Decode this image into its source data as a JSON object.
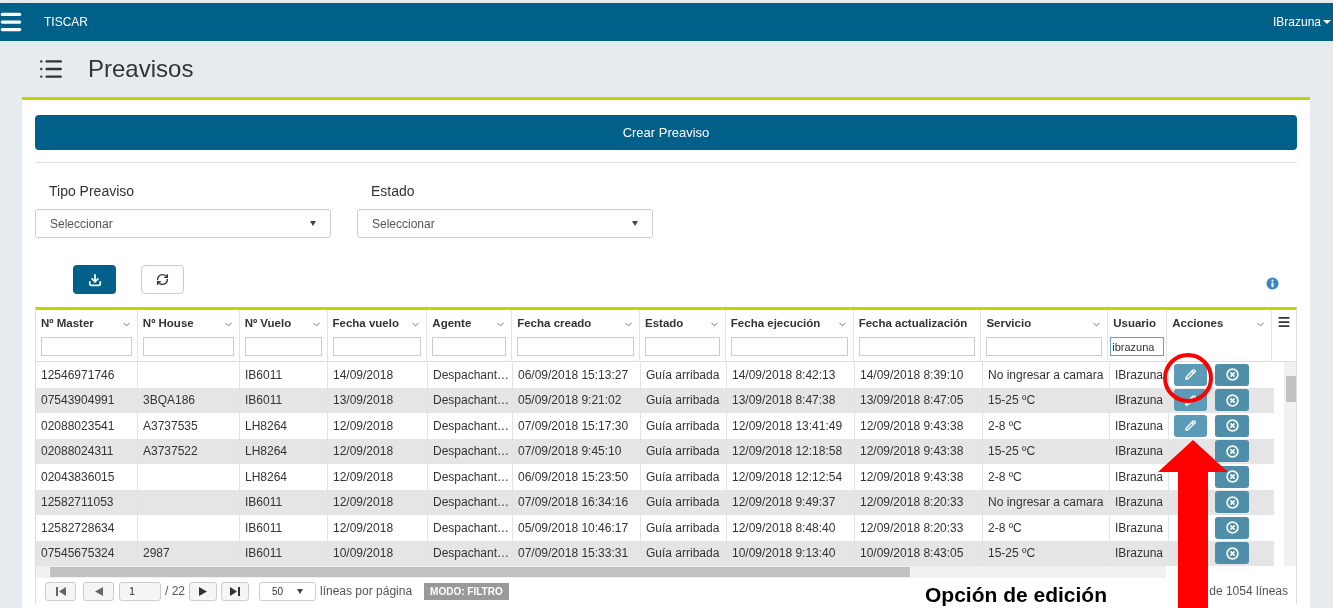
{
  "app_bar": {
    "title": "TISCAR",
    "user": "IBrazuna"
  },
  "page": {
    "title": "Preavisos"
  },
  "create_button": "Crear Preaviso",
  "filters": [
    {
      "label": "Tipo Preaviso",
      "value": "Seleccionar"
    },
    {
      "label": "Estado",
      "value": "Seleccionar"
    }
  ],
  "table": {
    "columns": [
      {
        "label": "Nº Master",
        "caret": true,
        "kind": "filter"
      },
      {
        "label": "Nº House",
        "caret": true,
        "kind": "filter"
      },
      {
        "label": "Nº Vuelo",
        "caret": true,
        "kind": "filter"
      },
      {
        "label": "Fecha vuelo",
        "caret": true,
        "kind": "filter"
      },
      {
        "label": "Agente",
        "caret": true,
        "kind": "filter"
      },
      {
        "label": "Fecha creado",
        "caret": true,
        "kind": "filter"
      },
      {
        "label": "Estado",
        "caret": true,
        "kind": "filter"
      },
      {
        "label": "Fecha ejecución",
        "caret": true,
        "kind": "filter"
      },
      {
        "label": "Fecha actualización",
        "caret": false,
        "kind": "filter"
      },
      {
        "label": "Servicio",
        "caret": true,
        "kind": "filter"
      },
      {
        "label": "Usuario",
        "caret": false,
        "kind": "filter",
        "filter_value": "ibrazuna"
      },
      {
        "label": "Acciones",
        "caret": true,
        "kind": "actions"
      }
    ],
    "rows": [
      {
        "cells": [
          "12546971746",
          null,
          "IB6011",
          "14/09/2018",
          "Despachant…",
          "06/09/2018 15:13:27",
          "Guía arribada",
          "14/09/2018 8:42:13",
          "14/09/2018 8:39:10",
          "No ingresar a camara",
          "IBrazuna"
        ]
      },
      {
        "cells": [
          "07543904991",
          "3BQA186",
          "IB6011",
          "13/09/2018",
          "Despachant…",
          "05/09/2018 9:21:02",
          "Guía arribada",
          "13/09/2018 8:47:38",
          "13/09/2018 8:47:05",
          "15-25 ºC",
          "IBrazuna"
        ]
      },
      {
        "cells": [
          "02088023541",
          "A3737535",
          "LH8264",
          "12/09/2018",
          "Despachant…",
          "07/09/2018 15:17:30",
          "Guía arribada",
          "12/09/2018 13:41:49",
          "12/09/2018 9:43:38",
          "2-8 ºC",
          "IBrazuna"
        ]
      },
      {
        "cells": [
          "02088024311",
          "A3737522",
          "LH8264",
          "12/09/2018",
          "Despachant…",
          "07/09/2018 9:45:10",
          "Guía arribada",
          "12/09/2018 12:18:58",
          "12/09/2018 9:43:38",
          "15-25 ºC",
          "IBrazuna"
        ]
      },
      {
        "cells": [
          "02043836015",
          null,
          "LH8264",
          "12/09/2018",
          "Despachant…",
          "06/09/2018 15:23:50",
          "Guía arribada",
          "12/09/2018 12:12:54",
          "12/09/2018 9:43:38",
          "2-8 ºC",
          "IBrazuna"
        ]
      },
      {
        "cells": [
          "12582711053",
          null,
          "IB6011",
          "12/09/2018",
          "Despachant…",
          "07/09/2018 16:34:16",
          "Guía arribada",
          "12/09/2018 9:49:37",
          "12/09/2018 8:20:33",
          "No ingresar a camara",
          "IBrazuna"
        ]
      },
      {
        "cells": [
          "12582728634",
          null,
          "IB6011",
          "12/09/2018",
          "Despachant…",
          "05/09/2018 10:46:17",
          "Guía arribada",
          "12/09/2018 8:48:40",
          "12/09/2018 8:20:33",
          "2-8 ºC",
          "IBrazuna"
        ]
      },
      {
        "cells": [
          "07545675324",
          "2987",
          "IB6011",
          "10/09/2018",
          "Despachant…",
          "07/09/2018 15:33:31",
          "Guía arribada",
          "10/09/2018 9:13:40",
          "10/09/2018 8:43:05",
          "15-25 ºC",
          "IBrazuna"
        ]
      }
    ]
  },
  "pager": {
    "page": "1",
    "pages": "/ 22",
    "page_size": "50",
    "page_size_label": "líneas por página",
    "mode": "MODO: FILTRO",
    "total": "de 1054 líneas"
  },
  "annotation": {
    "label": "Opción de edición"
  }
}
